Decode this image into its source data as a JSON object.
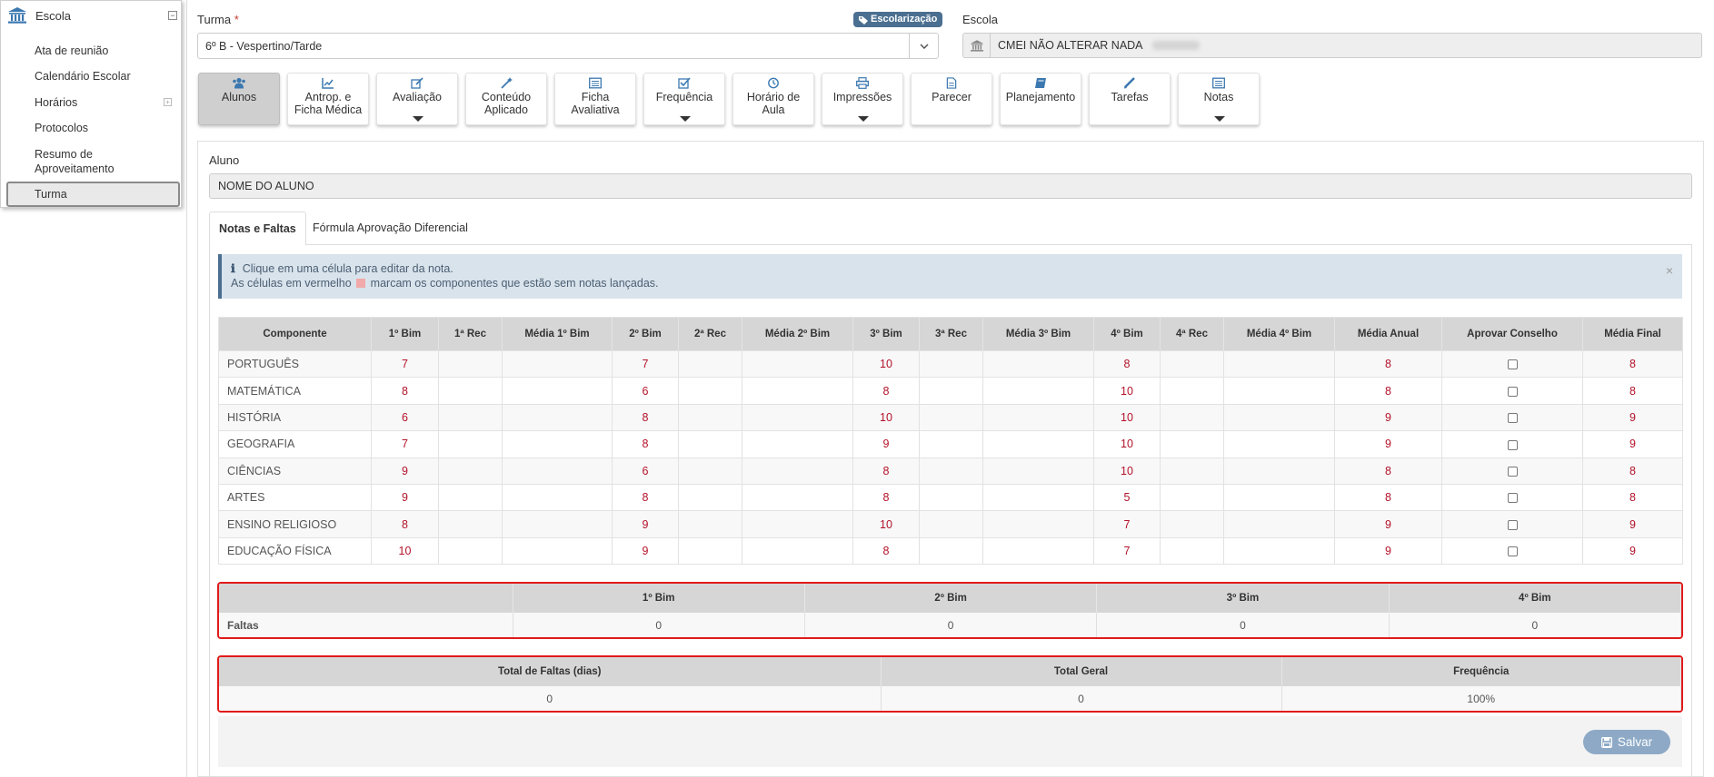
{
  "sidebar": {
    "title": "Escola",
    "items": [
      {
        "label": "Ata de reunião"
      },
      {
        "label": "Calendário Escolar"
      },
      {
        "label": "Horários"
      },
      {
        "label": "Protocolos"
      },
      {
        "label": "Resumo de Aproveitamento"
      },
      {
        "label": "Turma"
      }
    ]
  },
  "form": {
    "turma_label": "Turma",
    "turma_required": "*",
    "turma_value": "6º B - Vespertino/Tarde",
    "badge": "Escolarização",
    "escola_label": "Escola",
    "escola_value": "CMEI NÃO ALTERAR NADA"
  },
  "toolbar": [
    {
      "label": "Alunos",
      "icon": "users-icon"
    },
    {
      "label": "Antrop. e Ficha Médica",
      "icon": "chart-line-icon"
    },
    {
      "label": "Avaliação",
      "icon": "edit-icon"
    },
    {
      "label": "Conteúdo Aplicado",
      "icon": "magic-wand-icon"
    },
    {
      "label": "Ficha Avaliativa",
      "icon": "list-alt-icon"
    },
    {
      "label": "Frequência",
      "icon": "check-square-icon"
    },
    {
      "label": "Horário de Aula",
      "icon": "clock-icon"
    },
    {
      "label": "Impressões",
      "icon": "print-icon"
    },
    {
      "label": "Parecer",
      "icon": "file-icon"
    },
    {
      "label": "Planejamento",
      "icon": "book-icon"
    },
    {
      "label": "Tarefas",
      "icon": "pencil-icon"
    },
    {
      "label": "Notas",
      "icon": "list-alt-icon"
    }
  ],
  "aluno": {
    "label": "Aluno",
    "value": "NOME DO ALUNO"
  },
  "tabs": [
    "Notas e Faltas",
    "Fórmula Aprovação Diferencial"
  ],
  "alert": {
    "icon": "info-icon",
    "line1": "Clique em uma célula para editar da nota.",
    "line2_a": "As células em vermelho",
    "line2_b": "marcam os componentes que estão sem notas lançadas.",
    "close": "×"
  },
  "grades": {
    "headers": [
      "Componente",
      "1º Bim",
      "1ª Rec",
      "Média 1º Bim",
      "2º Bim",
      "2ª Rec",
      "Média 2º Bim",
      "3º Bim",
      "3ª Rec",
      "Média 3º Bim",
      "4º Bim",
      "4ª Rec",
      "Média 4º Bim",
      "Média Anual",
      "Aprovar Conselho",
      "Média Final"
    ],
    "rows": [
      [
        "PORTUGUÊS",
        "7",
        "",
        "",
        "7",
        "",
        "",
        "10",
        "",
        "",
        "8",
        "",
        "",
        "8",
        "",
        "8"
      ],
      [
        "MATEMÁTICA",
        "8",
        "",
        "",
        "6",
        "",
        "",
        "8",
        "",
        "",
        "10",
        "",
        "",
        "8",
        "",
        "8"
      ],
      [
        "HISTÓRIA",
        "6",
        "",
        "",
        "8",
        "",
        "",
        "10",
        "",
        "",
        "10",
        "",
        "",
        "9",
        "",
        "9"
      ],
      [
        "GEOGRAFIA",
        "7",
        "",
        "",
        "8",
        "",
        "",
        "9",
        "",
        "",
        "10",
        "",
        "",
        "9",
        "",
        "9"
      ],
      [
        "CIÊNCIAS",
        "9",
        "",
        "",
        "6",
        "",
        "",
        "8",
        "",
        "",
        "10",
        "",
        "",
        "8",
        "",
        "8"
      ],
      [
        "ARTES",
        "9",
        "",
        "",
        "8",
        "",
        "",
        "8",
        "",
        "",
        "5",
        "",
        "",
        "8",
        "",
        "8"
      ],
      [
        "ENSINO RELIGIOSO",
        "8",
        "",
        "",
        "9",
        "",
        "",
        "10",
        "",
        "",
        "7",
        "",
        "",
        "9",
        "",
        "9"
      ],
      [
        "EDUCAÇÃO FÍSICA",
        "10",
        "",
        "",
        "9",
        "",
        "",
        "8",
        "",
        "",
        "7",
        "",
        "",
        "9",
        "",
        "9"
      ]
    ]
  },
  "faltas": {
    "headers": [
      "",
      "1º Bim",
      "2º Bim",
      "3º Bim",
      "4º Bim"
    ],
    "row_label": "Faltas",
    "values": [
      "0",
      "0",
      "0",
      "0"
    ]
  },
  "totais": {
    "headers": [
      "Total de Faltas (dias)",
      "Total Geral",
      "Frequência"
    ],
    "values": [
      "0",
      "0",
      "100%"
    ]
  },
  "save_label": "Salvar"
}
